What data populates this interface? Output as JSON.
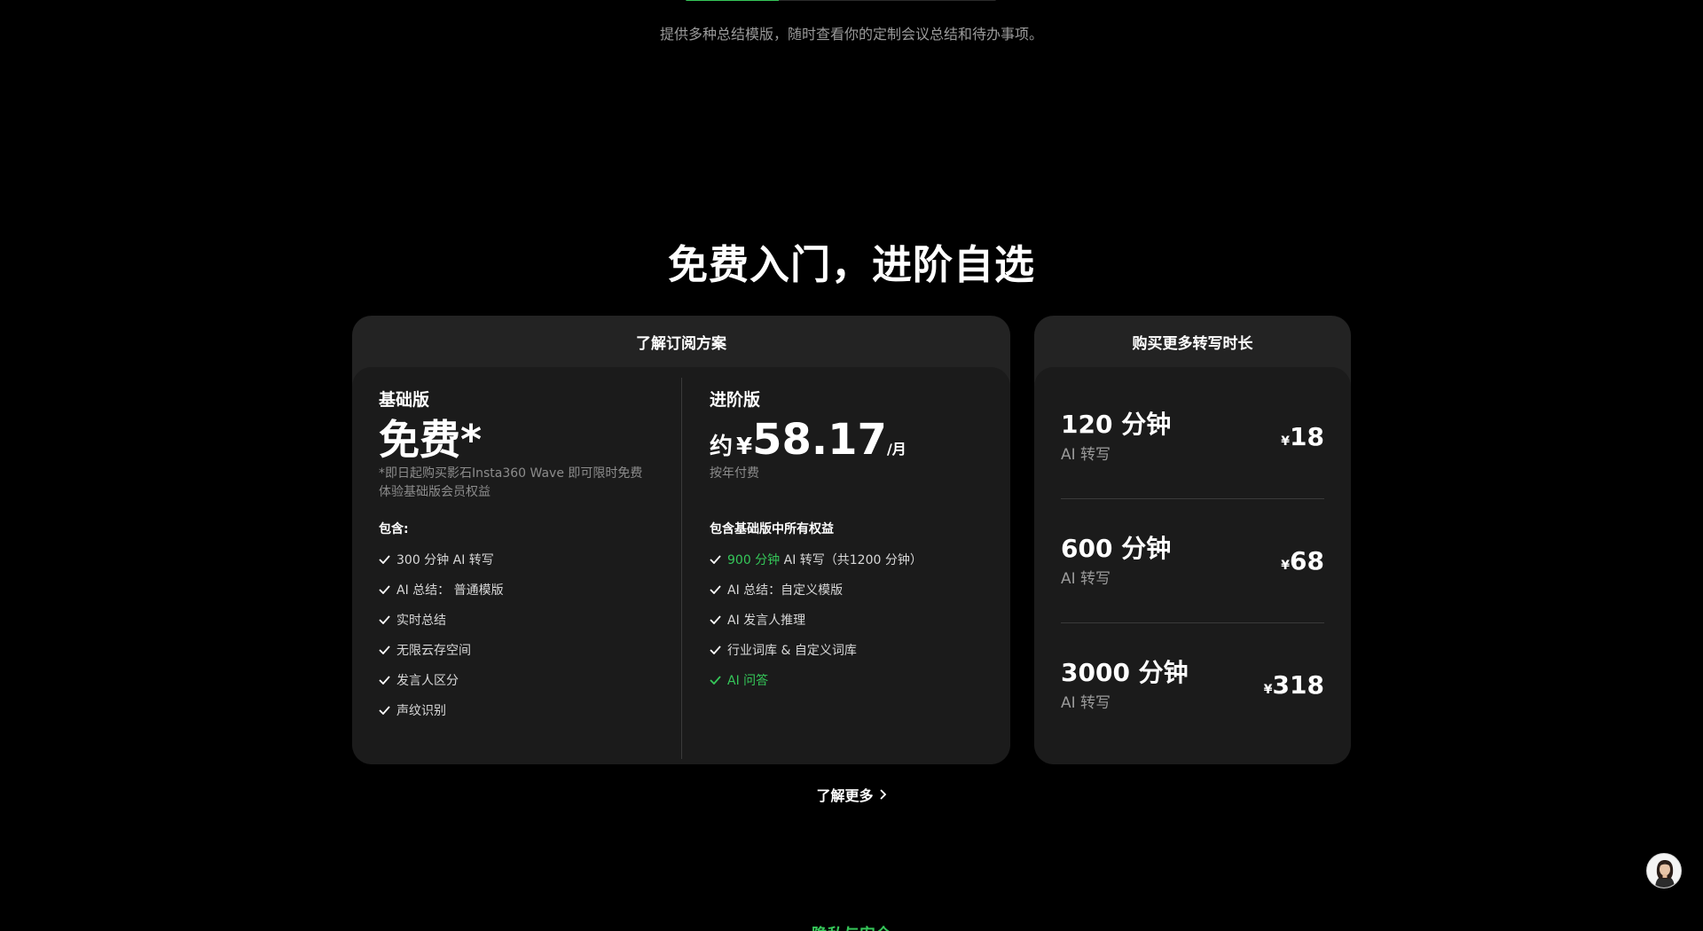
{
  "top": {
    "progress_fraction": 0.3,
    "subtitle": "提供多种总结模版，随时查看你的定制会议总结和待办事项。"
  },
  "pricing": {
    "title": "免费入门，进阶自选",
    "subscription_card": {
      "header": "了解订阅方案",
      "basic": {
        "name": "基础版",
        "price": "免费*",
        "note": "*即日起购买影石Insta360 Wave 即可限时免费体验基础版会员权益",
        "features_head": "包含:",
        "features": [
          "300 分钟 AI 转写",
          "AI 总结： 普通模版",
          "实时总结",
          "无限云存空间",
          "发言人区分",
          "声纹识别"
        ]
      },
      "pro": {
        "name": "进阶版",
        "price_prefix": "约",
        "currency": "¥",
        "amount": "58.17",
        "unit": "/月",
        "note": "按年付费",
        "features_head": "包含基础版中所有权益",
        "feature_1_highlight": "900 分钟",
        "feature_1_rest": " AI 转写（共1200 分钟）",
        "feature_2": "AI 总结：自定义模版",
        "feature_3": "AI 发言人推理",
        "feature_4": "行业词库 & 自定义词库",
        "feature_5": "AI 问答"
      }
    },
    "buy_card": {
      "header": "购买更多转写时长",
      "items": [
        {
          "minutes": "120 分钟",
          "label": "AI 转写",
          "currency": "¥",
          "price": "18"
        },
        {
          "minutes": "600 分钟",
          "label": "AI 转写",
          "currency": "¥",
          "price": "68"
        },
        {
          "minutes": "3000 分钟",
          "label": "AI 转写",
          "currency": "¥",
          "price": "318"
        }
      ]
    },
    "learn_more": "了解更多"
  },
  "next_section": {
    "title": "隐私与安全"
  },
  "colors": {
    "accent": "#35c759",
    "background": "#000000",
    "card": "#232323",
    "card_inner": "#1b1b1b"
  }
}
